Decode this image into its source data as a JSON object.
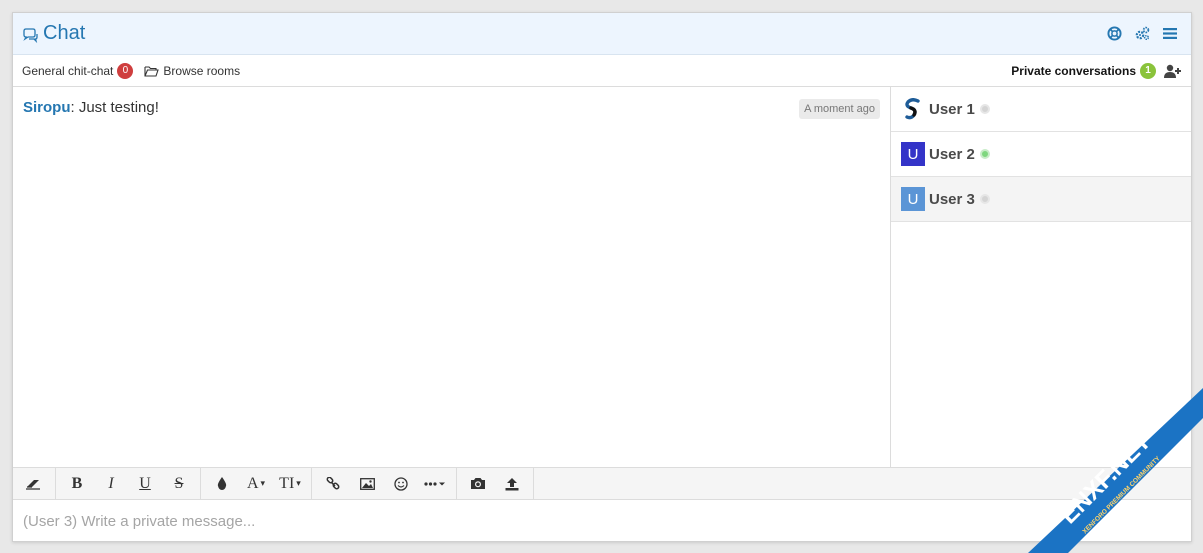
{
  "header": {
    "title": "Chat",
    "icons": [
      "chat-bubbles-icon",
      "lifebuoy-icon",
      "cogs-icon",
      "menu-icon"
    ],
    "accent_color": "#2577b1"
  },
  "rooms": {
    "current_room": "General chit-chat",
    "current_room_badge": "0",
    "browse_label": "Browse rooms",
    "private_label": "Private conversations",
    "private_badge": "1"
  },
  "messages": [
    {
      "user": "Siropu",
      "separator": ":",
      "text": " Just testing!",
      "time": "A moment ago"
    }
  ],
  "users": [
    {
      "name": "User 1",
      "avatar": "logo",
      "status": "offline",
      "status_color": "#cccccc"
    },
    {
      "name": "User 2",
      "avatar": "U",
      "avatar_color": "#3434c8",
      "status": "online",
      "status_color": "#7fd77f"
    },
    {
      "name": "User 3",
      "avatar": "U",
      "avatar_color": "#5b95d6",
      "status": "offline",
      "status_color": "#cccccc"
    }
  ],
  "toolbar": {
    "buttons": [
      "eraser-icon",
      "bold-icon",
      "italic-icon",
      "underline-icon",
      "strikethrough-icon",
      "color-icon",
      "font-family-icon",
      "font-size-icon",
      "link-icon",
      "image-icon",
      "smiley-icon",
      "more-icon",
      "camera-icon",
      "upload-icon"
    ],
    "bold": "B",
    "italic": "I",
    "underline": "U",
    "strike": "S",
    "font": "A",
    "size": "TI"
  },
  "editor": {
    "placeholder": "(User 3) Write a private message..."
  },
  "watermark": {
    "main": "ENXF.NET",
    "sub": "XENFORO PREMIUM COMMUNITY"
  }
}
